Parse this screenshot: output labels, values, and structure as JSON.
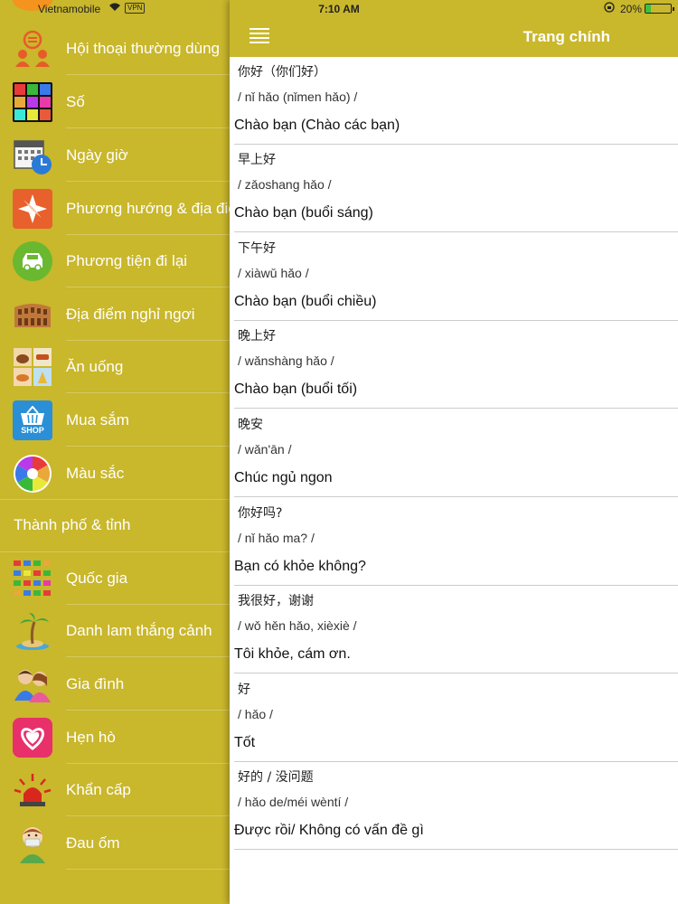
{
  "status_bar": {
    "carrier": "Vietnamobile",
    "vpn": "VPN",
    "time": "7:10 AM",
    "battery": "20%"
  },
  "sidebar": {
    "items": [
      {
        "label": "Hội thoại thường dùng",
        "icon": "conversation-icon",
        "color": "#f2ead0"
      },
      {
        "label": "Số",
        "icon": "numbers-icon",
        "color": "#222222"
      },
      {
        "label": "Ngày giờ",
        "icon": "calendar-clock-icon",
        "color": "#3a6fb0"
      },
      {
        "label": "Phương hướng & địa điểm",
        "icon": "compass-icon",
        "color": "#e8602c"
      },
      {
        "label": "Phương tiện đi lại",
        "icon": "car-icon",
        "color": "#6ab82f"
      },
      {
        "label": "Địa điểm nghỉ ngơi",
        "icon": "colosseum-icon",
        "color": "#b8692a"
      },
      {
        "label": "Ăn uống",
        "icon": "food-icon",
        "color": "#d9a04a"
      },
      {
        "label": "Mua sắm",
        "icon": "shop-basket-icon",
        "color": "#2a8fd6"
      },
      {
        "label": "Màu sắc",
        "icon": "color-wheel-icon",
        "color": "#ffffff"
      }
    ],
    "section": "Thành phố & tỉnh",
    "items2": [
      {
        "label": "Quốc gia",
        "icon": "flags-icon",
        "color": "#d6c65a"
      },
      {
        "label": "Danh lam thắng cảnh",
        "icon": "palm-island-icon",
        "color": "#4aa8d8"
      },
      {
        "label": "Gia đình",
        "icon": "family-icon",
        "color": "#f0c9a0"
      },
      {
        "label": "Hẹn hò",
        "icon": "heart-icon",
        "color": "#e8306a"
      },
      {
        "label": "Khẩn cấp",
        "icon": "siren-icon",
        "color": "#d8281e"
      },
      {
        "label": "Đau ốm",
        "icon": "sick-person-icon",
        "color": "#5aa84a"
      }
    ],
    "shop_text": "SHOP",
    "number_grid": [
      "1",
      "2",
      "3",
      "5",
      "6",
      "7",
      "9",
      "0",
      "#"
    ]
  },
  "navbar": {
    "title": "Trang chính"
  },
  "phrases": [
    {
      "cn": "你好（你们好）",
      "pinyin": "/ nǐ hǎo (nǐmen hǎo) /",
      "vi": "Chào bạn (Chào các bạn)"
    },
    {
      "cn": "早上好",
      "pinyin": "/ zǎoshang hǎo /",
      "vi": "Chào bạn (buổi sáng)"
    },
    {
      "cn": "下午好",
      "pinyin": "/ xiàwǔ hǎo /",
      "vi": "Chào bạn (buổi chiều)"
    },
    {
      "cn": "晚上好",
      "pinyin": "/ wǎnshàng hǎo /",
      "vi": "Chào bạn (buổi tối)"
    },
    {
      "cn": "晚安",
      "pinyin": "/ wǎn'ān /",
      "vi": "Chúc ngủ ngon"
    },
    {
      "cn": "你好吗?",
      "pinyin": "/ nǐ hǎo ma? /",
      "vi": "Bạn có khỏe không?"
    },
    {
      "cn": "我很好，谢谢",
      "pinyin": "/ wǒ hěn hǎo, xièxiè /",
      "vi": "Tôi khỏe, cám ơn."
    },
    {
      "cn": "好",
      "pinyin": "/ hǎo /",
      "vi": "Tốt"
    },
    {
      "cn": "好的 / 没问题",
      "pinyin": "/ hǎo de/méi wèntí /",
      "vi": "Được rồi/ Không có vấn đề gì"
    }
  ]
}
